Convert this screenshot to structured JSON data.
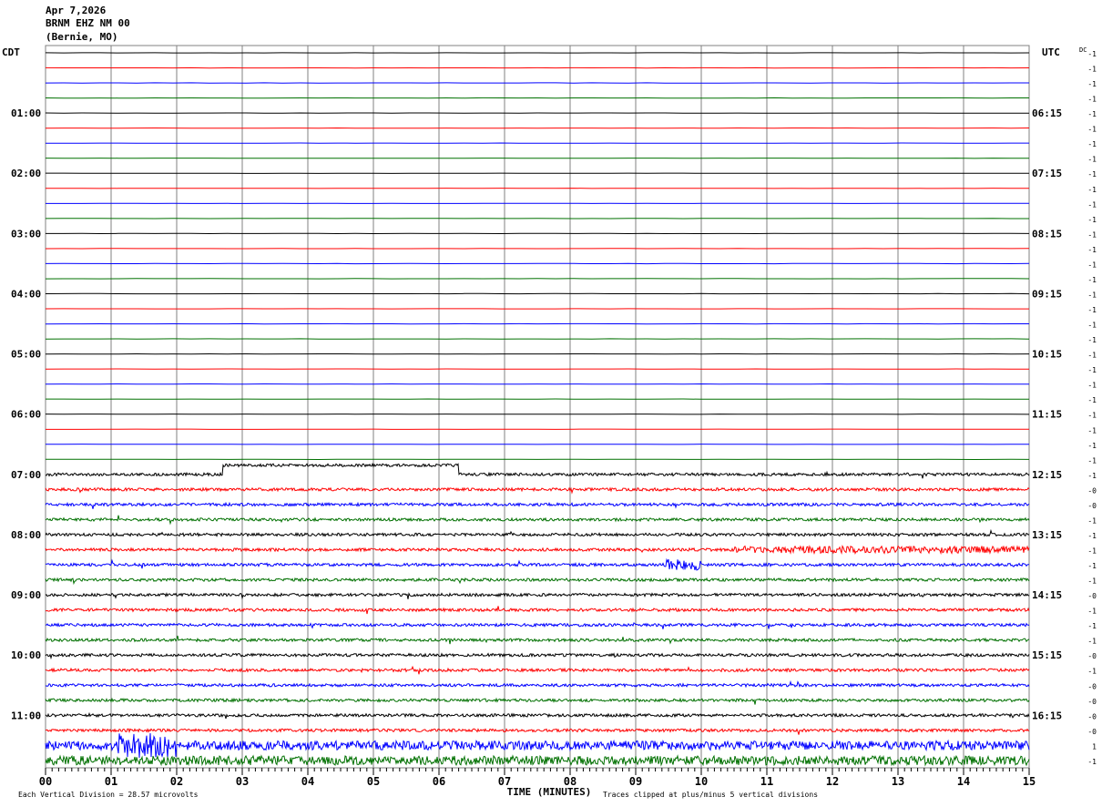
{
  "header": {
    "date": "Apr 7,2026",
    "station": "BRNM EHZ NM 00",
    "location": "(Bernie, MO)"
  },
  "chart_data": {
    "type": "line",
    "title": "Apr 7,2026 BRNM EHZ NM 00 (Bernie, MO)",
    "xlabel": "TIME (MINUTES)",
    "xlim": [
      0,
      15
    ],
    "x_ticks": [
      "00",
      "01",
      "02",
      "03",
      "04",
      "05",
      "06",
      "07",
      "08",
      "09",
      "10",
      "11",
      "12",
      "13",
      "14",
      "15"
    ],
    "left_timezone": "CDT",
    "right_timezone": "UTC",
    "dc_label": "DC",
    "left_hour_labels": [
      "01:00",
      "02:00",
      "03:00",
      "04:00",
      "05:00",
      "06:00",
      "07:00",
      "08:00",
      "09:00",
      "10:00",
      "11:00"
    ],
    "right_hour_labels": [
      "06:15",
      "07:15",
      "08:15",
      "09:15",
      "10:15",
      "11:15",
      "12:15",
      "13:15",
      "14:15",
      "15:15",
      "16:15"
    ],
    "row_minutes": 15,
    "row_colors": [
      "#000000",
      "#ff0000",
      "#0000ff",
      "#007000"
    ],
    "dc_offsets": [
      "-1",
      "-1",
      "-1",
      "-1",
      "-1",
      "-1",
      "-1",
      "-1",
      "-1",
      "-1",
      "-1",
      "-1",
      "-1",
      "-1",
      "-1",
      "-1",
      "-1",
      "-1",
      "-1",
      "-1",
      "-1",
      "-1",
      "-1",
      "-1",
      "-1",
      "-1",
      "-1",
      "-1",
      "-1",
      "-0",
      "-0",
      "-1",
      "-1",
      "-1",
      "-1",
      "-1",
      "-0",
      "-1",
      "-1",
      "-1",
      "-0",
      "-1",
      "-0",
      "-0",
      "-0",
      "-0",
      "1",
      "-1"
    ],
    "grid": true,
    "footer_scale": "Each Vertical Division =   28.57 microvolts",
    "footer_clip": "Traces clipped at plus/minus 5 vertical divisions",
    "grid_color": "#808080"
  }
}
